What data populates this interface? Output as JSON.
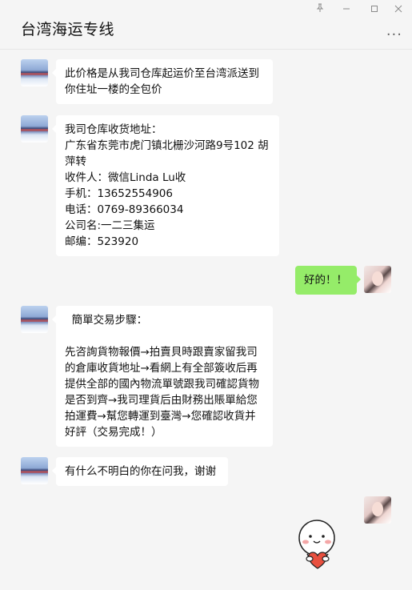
{
  "window": {
    "title": "台湾海运专线",
    "controls": [
      "pin-icon",
      "minimize-icon",
      "maximize-icon",
      "close-icon"
    ],
    "more_label": "..."
  },
  "messages": [
    {
      "sender": "seller",
      "text": "此价格是从我司仓库起运价至台湾派送到\n你住址一楼的全包价"
    },
    {
      "sender": "seller",
      "text": "我司仓库收货地址：\n广东省东莞市虎门镇北栅沙河路9号102 胡\n萍转\n收件人：微信Linda Lu收\n手机：13652554906\n电话：0769-89366034\n公司名:一二三集运\n邮编：523920"
    },
    {
      "sender": "buyer",
      "text": "好的！！"
    },
    {
      "sender": "seller",
      "text": "  簡單交易步驟：\n\n先咨詢貨物報價→拍賣貝時跟賣家留我司\n的倉庫收貨地址→看網上有全部簽收后再\n提供全部的國內物流單號跟我司確認貨物\n是否到齊→我司理貨后由財務出賬單給您\n拍運費→幫您轉運到臺灣→您確認收貨并\n好評（交易完成！）"
    },
    {
      "sender": "seller",
      "text": "有什么不明白的你在问我，谢谢"
    },
    {
      "sender": "buyer",
      "sticker": "heart-hug-sticker"
    }
  ],
  "colors": {
    "background": "#f5f5f5",
    "incoming_bubble": "#ffffff",
    "outgoing_bubble": "#95ec69"
  }
}
